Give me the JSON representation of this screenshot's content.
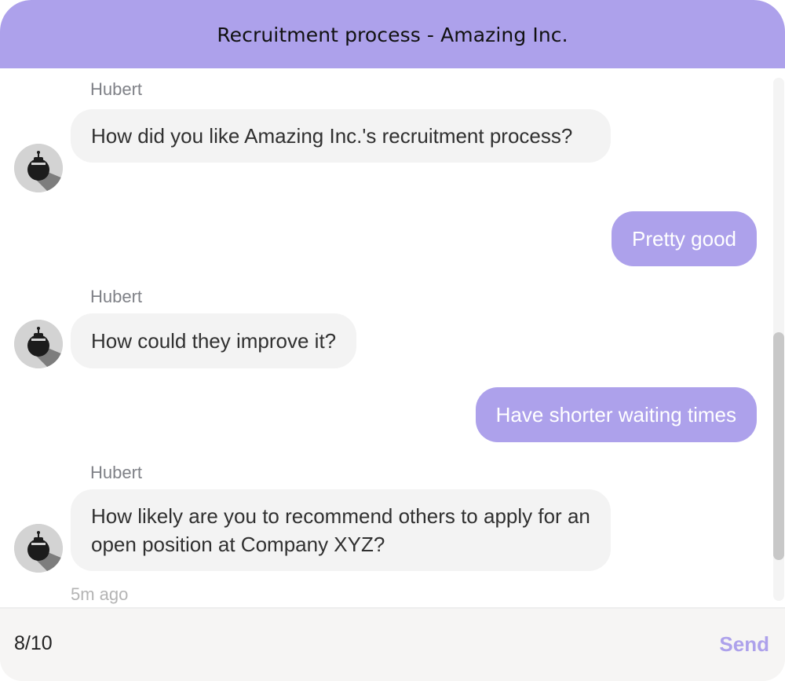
{
  "header": {
    "title": "Recruitment process - Amazing Inc."
  },
  "conversation": {
    "messages": [
      {
        "from": "bot",
        "sender": "Hubert",
        "text": "How did you like Amazing Inc.'s recruitment process?"
      },
      {
        "from": "user",
        "text": "Pretty good"
      },
      {
        "from": "bot",
        "sender": "Hubert",
        "text": "How could they improve it?"
      },
      {
        "from": "user",
        "text": "Have shorter waiting times"
      },
      {
        "from": "bot",
        "sender": "Hubert",
        "text": "How likely are you to recommend others to apply for an open position at Company XYZ?"
      }
    ],
    "last_timestamp": "5m ago"
  },
  "composer": {
    "value": "8/10",
    "send_label": "Send"
  },
  "colors": {
    "accent": "#ada1eb",
    "bubble_bot": "#f3f3f3",
    "composer_bg": "#f6f5f4"
  },
  "icons": {
    "avatar": "robot-avatar-icon"
  }
}
